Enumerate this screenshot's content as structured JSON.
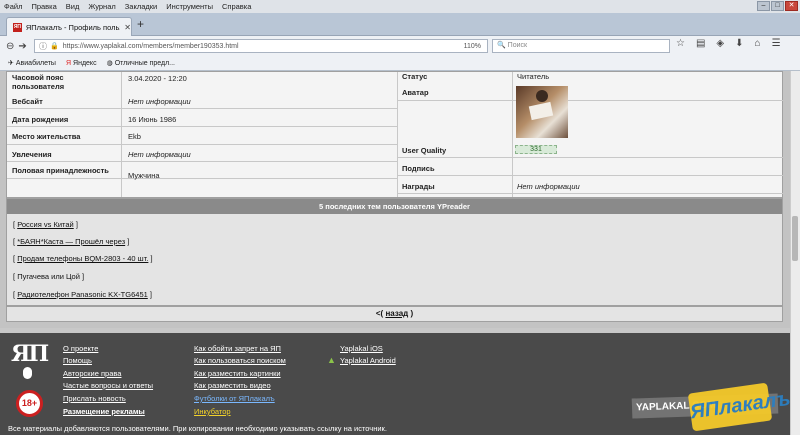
{
  "browser": {
    "menu": [
      "Файл",
      "Правка",
      "Вид",
      "Журнал",
      "Закладки",
      "Инструменты",
      "Справка"
    ],
    "tab_title": "ЯПлакалъ - Профиль пользователя",
    "favicon_text": "ЯП",
    "new_tab": "+",
    "url": "https://www.yaplakal.com/members/member190353.html",
    "zoom": "110%",
    "search_placeholder": "Поиск",
    "bookmarks": [
      "Авиабилеты",
      "Яндекс",
      "Отличные предл..."
    ]
  },
  "profile": {
    "rows_left": [
      {
        "label": "Часовой пояс пользователя",
        "value": "3.04.2020 - 12:20"
      },
      {
        "label": "Вебсайт",
        "value": "Нет информации"
      },
      {
        "label": "Дата рождения",
        "value": "16 Июнь 1986"
      },
      {
        "label": "Место жительства",
        "value": "Ekb"
      },
      {
        "label": "Увлечения",
        "value": "Нет информации"
      },
      {
        "label": "Половая принадлежность",
        "value": "Мужчина"
      }
    ],
    "rows_right": [
      {
        "label": "Статус",
        "value": "Читатель"
      },
      {
        "label": "Аватар",
        "value": ""
      },
      {
        "label": "User Quality",
        "value": "331"
      },
      {
        "label": "Подпись",
        "value": ""
      },
      {
        "label": "Награды",
        "value": "Нет информации"
      }
    ]
  },
  "topics": {
    "header": "5 последних тем пользователя YPreader",
    "items": [
      "Россия vs Китай",
      "*БАЯН*Каста — Прошёл через",
      "Продам телефоны BQM-2803 - 40 шт.",
      "Пугачева или Цой",
      "Радиотелефон Panasonic KX-TG6451"
    ],
    "bracket_open": "[",
    "bracket_close": "]"
  },
  "pager": {
    "prefix": "<(",
    "link": "назад",
    "suffix": ")"
  },
  "footer": {
    "logo": "ЯП",
    "age": "18+",
    "col1": [
      "О проекте",
      "Помощь",
      "Авторские права",
      "Частые вопросы и ответы",
      "Прислать новость",
      "Размещение рекламы"
    ],
    "col2": [
      "Как обойти запрет на ЯП",
      "Как пользоваться поиском",
      "Как разместить картинки",
      "Как разместить видео",
      "Футболки от ЯПлакалъ",
      "Инкубатор"
    ],
    "col3": [
      "Yaplakal iOS",
      "Yaplakal Android"
    ],
    "copyright": "Все материалы добавляются пользователями. При копировании необходимо указывать ссылку на источник."
  },
  "watermark": {
    "text": "YAPLAKAL.COM",
    "logo": "ЯПлакалъ"
  },
  "colors": {
    "accent": "#c2211c",
    "footer_bg": "#4a4a4a",
    "link_yellow": "#f2d22a"
  }
}
